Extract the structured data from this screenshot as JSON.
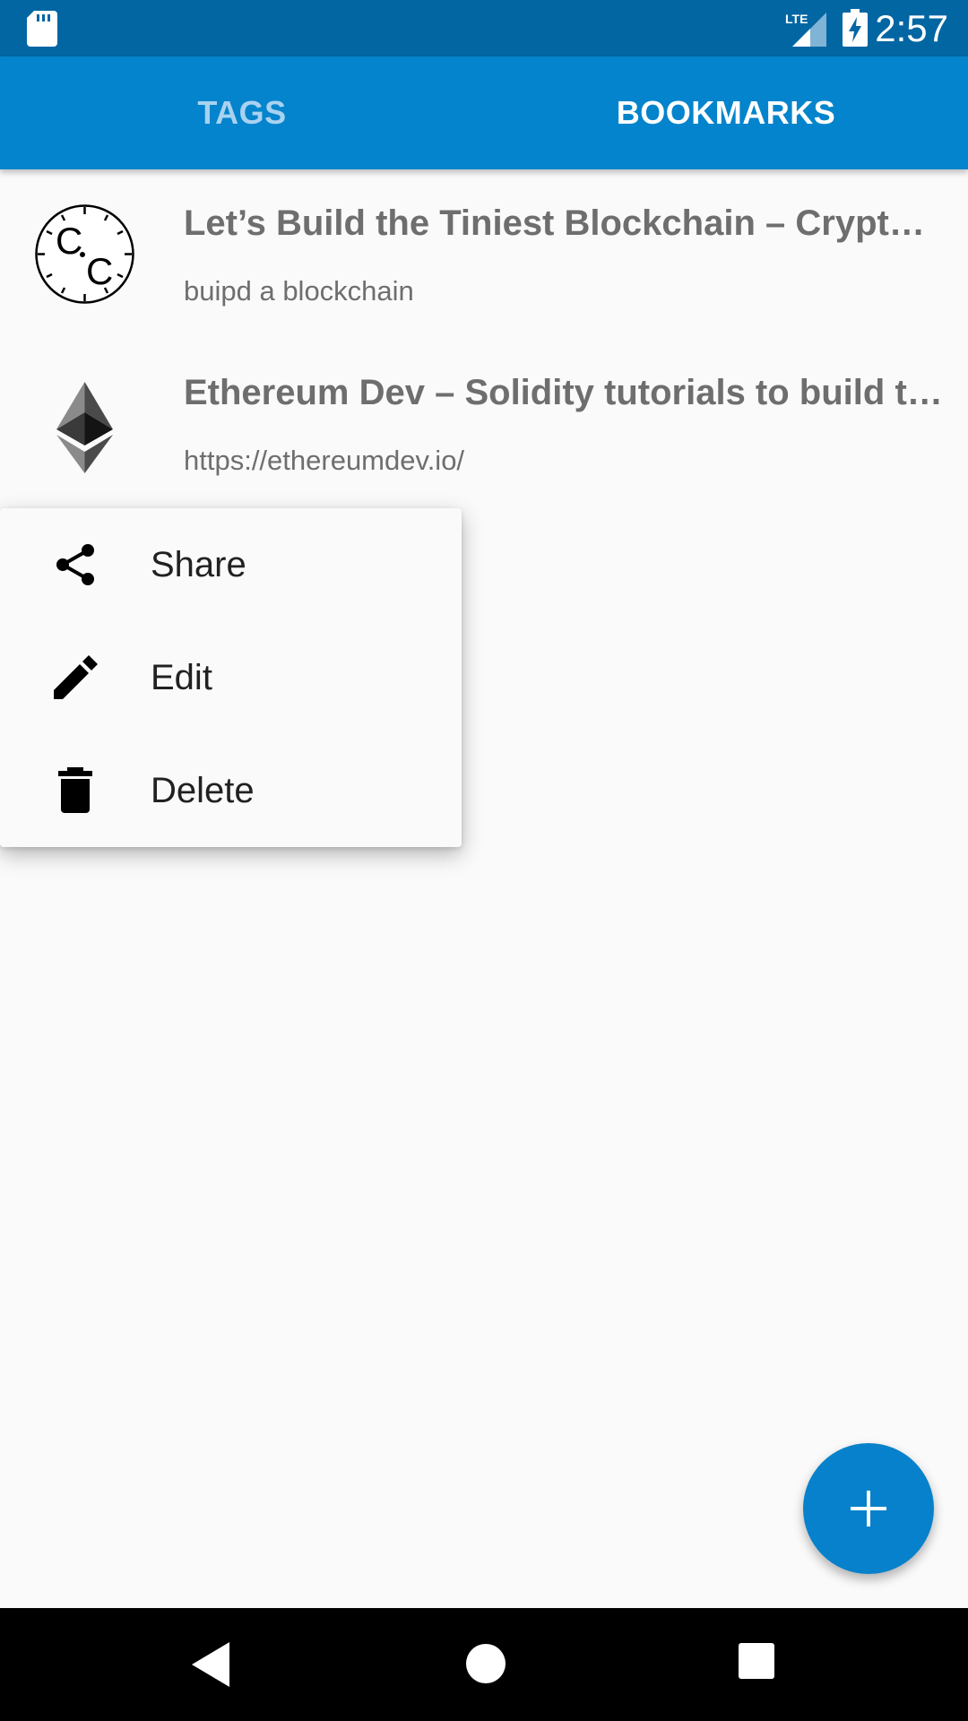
{
  "status_bar": {
    "time": "2:57",
    "network_label": "LTE",
    "icons": [
      "sd-card-icon",
      "lte-signal-icon",
      "battery-charging-icon"
    ]
  },
  "tabs": [
    {
      "label": "TAGS",
      "selected": false
    },
    {
      "label": "BOOKMARKS",
      "selected": true
    }
  ],
  "bookmarks": [
    {
      "title": "Let’s Build the Tiniest Blockchain – Crypto…",
      "subtitle": "buipd a blockchain",
      "icon": "clock-favicon-icon"
    },
    {
      "title": "Ethereum Dev – Solidity tutorials to build th…",
      "subtitle": "https://ethereumdev.io/",
      "icon": "ethereum-icon"
    }
  ],
  "context_menu": {
    "items": [
      {
        "label": "Share",
        "icon": "share-icon"
      },
      {
        "label": "Edit",
        "icon": "pencil-icon"
      },
      {
        "label": "Delete",
        "icon": "trash-icon"
      }
    ]
  },
  "fab": {
    "icon": "plus-icon"
  },
  "nav_bar": {
    "icons": [
      "back-icon",
      "home-icon",
      "recents-icon"
    ]
  },
  "colors": {
    "status_bar": "#0266a3",
    "app_bar": "#0484cc",
    "fab": "#0781cb",
    "tab_inactive": "#a9d2f0",
    "text_secondary": "#6e6e6e"
  }
}
